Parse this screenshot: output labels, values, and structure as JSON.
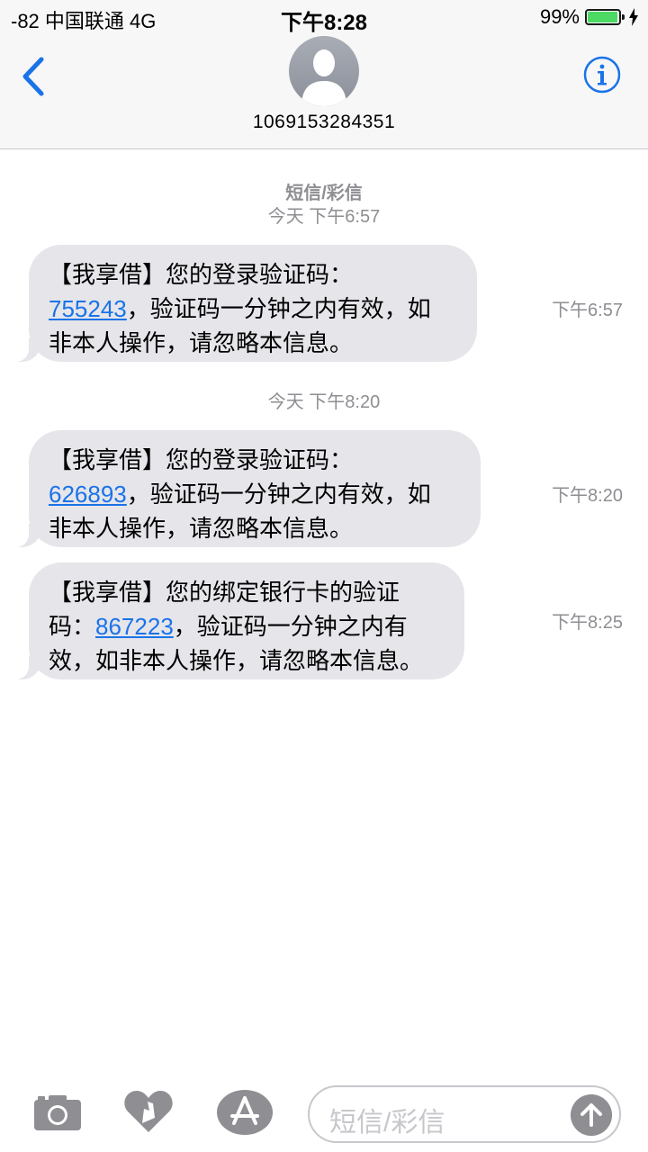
{
  "status_bar": {
    "signal_carrier": "-82 中国联通   4G",
    "time": "下午8:28",
    "battery_percent": "99%",
    "battery_level": 0.99
  },
  "header": {
    "contact": "1069153284351",
    "icons": [
      "back-chevron-icon",
      "contact-avatar-icon",
      "info-icon"
    ]
  },
  "thread": {
    "kind": "短信/彩信",
    "groups": [
      {
        "header": "今天 下午6:57",
        "messages": [
          {
            "line1": "【我享借】您的登录验证码：",
            "code": "755243",
            "line2_rest": "，验证码一分钟之内有效，如",
            "line3": "非本人操作，请忽略本信息。",
            "time": "下午6:57"
          }
        ]
      },
      {
        "header": "今天 下午8:20",
        "messages": [
          {
            "line1": "【我享借】您的登录验证码：",
            "code": "626893",
            "line2_rest": "，验证码一分钟之内有效，如",
            "line3": "非本人操作，请忽略本信息。",
            "time": "下午8:20"
          },
          {
            "line1": "【我享借】您的绑定银行卡的验证",
            "line2_prefix": "码：",
            "code": "867223",
            "line2_rest": "，验证码一分钟之内有",
            "line3": "效，如非本人操作，请忽略本信息。",
            "time": "下午8:25"
          }
        ]
      }
    ]
  },
  "composer": {
    "placeholder": "短信/彩信",
    "icons": [
      "camera-icon",
      "digital-touch-icon",
      "app-store-icon",
      "send-arrow-icon"
    ]
  },
  "colors": {
    "ios_blue": "#1a73e8",
    "bubble_gray": "#e5e5ea",
    "timestamp_gray": "#8e8e93",
    "battery_green": "#4cd964"
  }
}
